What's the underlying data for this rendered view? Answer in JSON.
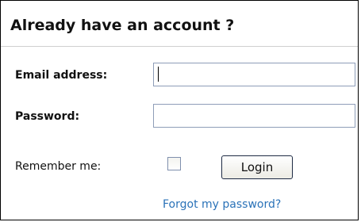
{
  "login": {
    "title": "Already have an account ?",
    "email_label": "Email address:",
    "email_value": "",
    "password_label": "Password:",
    "password_value": "",
    "remember_label": "Remember me:",
    "remember_checked": false,
    "login_button": "Login",
    "forgot_link": "Forgot my password?"
  },
  "colors": {
    "link": "#2a72b8",
    "input_border": "#8e9db8",
    "button_border": "#1e2b44"
  }
}
